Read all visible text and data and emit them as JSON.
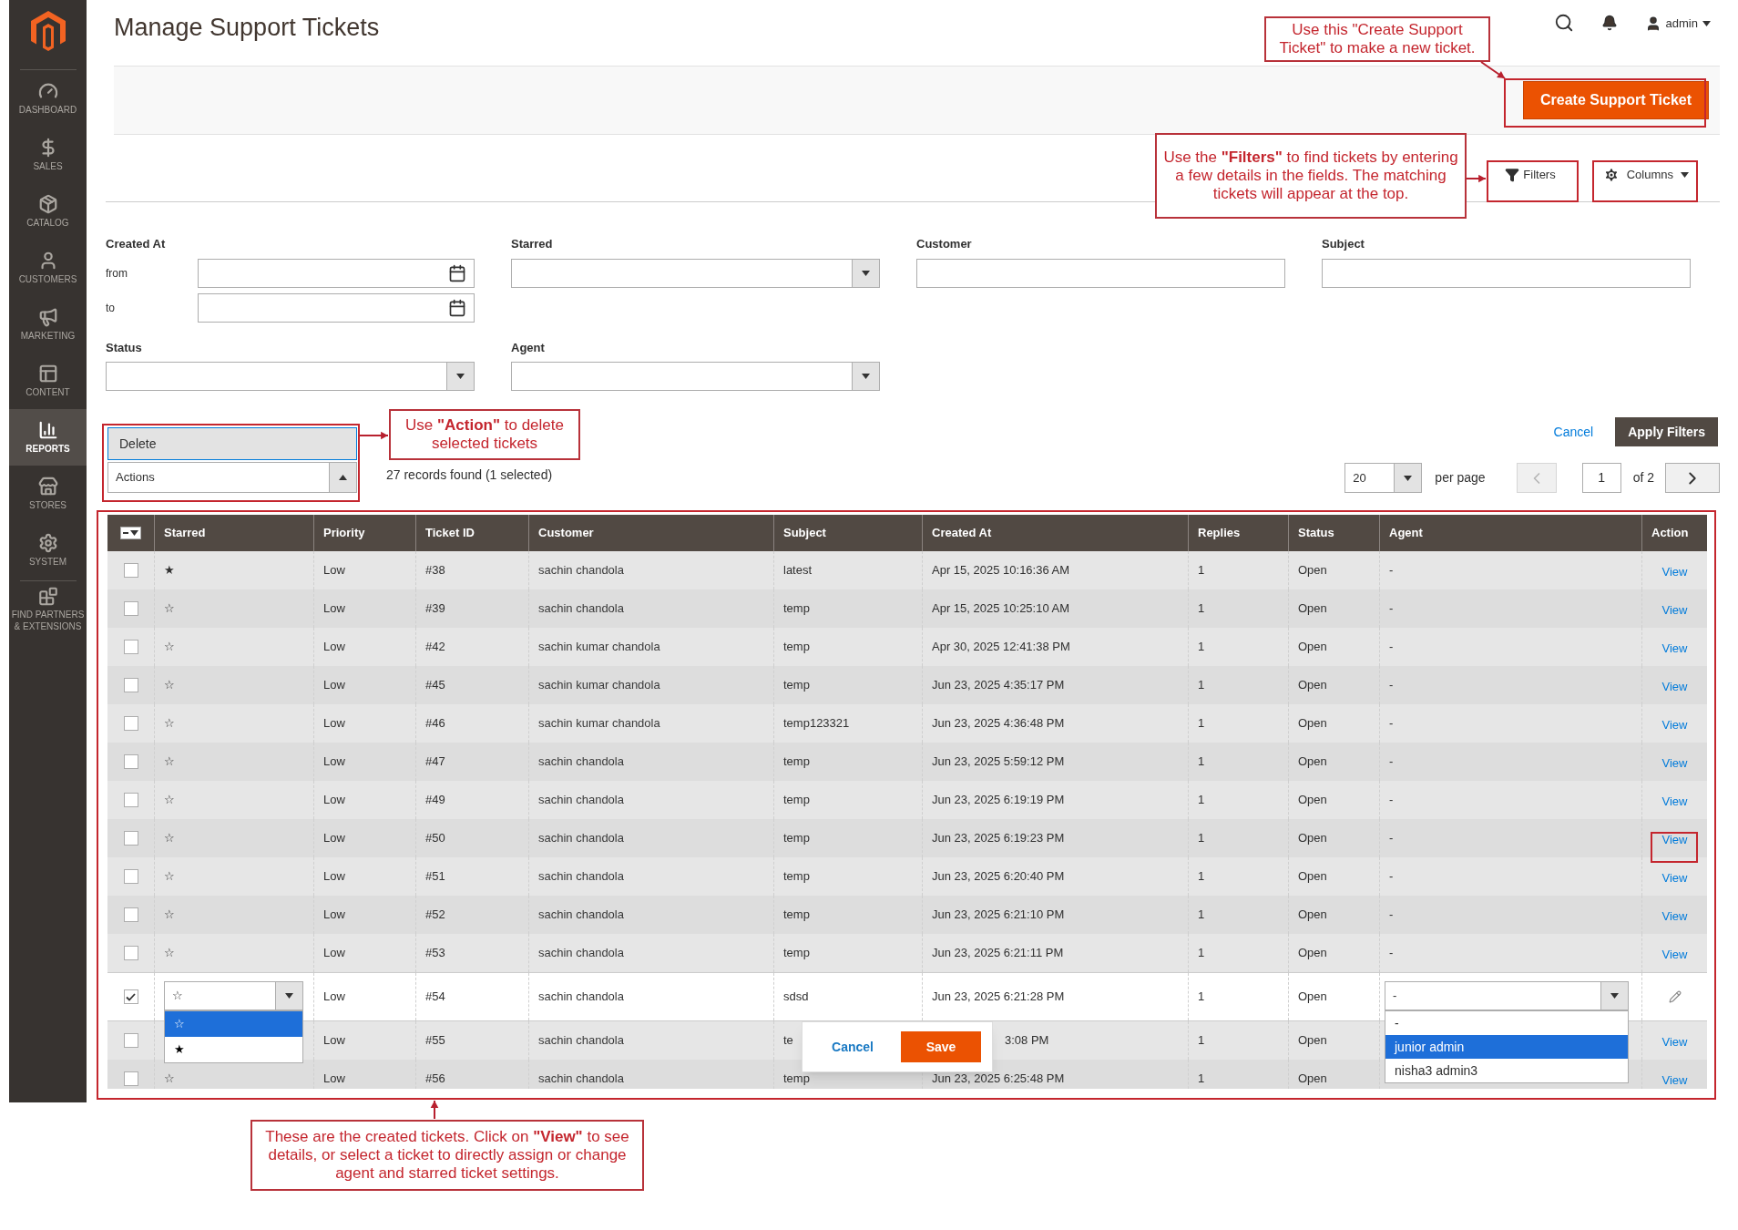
{
  "sidebar": {
    "items": [
      {
        "label": "DASHBOARD",
        "selected": false
      },
      {
        "label": "SALES",
        "selected": false
      },
      {
        "label": "CATALOG",
        "selected": false
      },
      {
        "label": "CUSTOMERS",
        "selected": false
      },
      {
        "label": "MARKETING",
        "selected": false
      },
      {
        "label": "CONTENT",
        "selected": false
      },
      {
        "label": "REPORTS",
        "selected": true
      },
      {
        "label": "STORES",
        "selected": false
      },
      {
        "label": "SYSTEM",
        "selected": false
      },
      {
        "label": "FIND PARTNERS & EXTENSIONS",
        "selected": false
      }
    ]
  },
  "header": {
    "title": "Manage Support Tickets",
    "user": "admin"
  },
  "create_button": "Create Support Ticket",
  "toolbar": {
    "filters_button": "Filters",
    "columns_button": "Columns"
  },
  "filters": {
    "created_at": "Created At",
    "from": "from",
    "to": "to",
    "starred": "Starred",
    "customer": "Customer",
    "subject": "Subject",
    "status": "Status",
    "agent": "Agent"
  },
  "actions": {
    "value": "Actions",
    "expanded": true,
    "options": [
      "Delete"
    ]
  },
  "records": "27 records found (1 selected)",
  "filter_buttons": {
    "cancel": "Cancel",
    "apply": "Apply Filters"
  },
  "pagination": {
    "per_page_value": "20",
    "per_page_label": "per page",
    "page": "1",
    "of": "of 2"
  },
  "table": {
    "mass_select_partial": true,
    "columns": [
      "Starred",
      "Priority",
      "Ticket ID",
      "Customer",
      "Subject",
      "Created At",
      "Replies",
      "Status",
      "Agent",
      "Action"
    ],
    "rows": [
      {
        "kind": "plain",
        "checked": false,
        "starred": "★",
        "priority": "Low",
        "ticket_id": "#38",
        "customer": "sachin chandola",
        "subject": "latest",
        "created_at": "Apr 15, 2025 10:16:36 AM",
        "replies": "1",
        "status": "Open",
        "agent": "-",
        "action": "View"
      },
      {
        "kind": "plain",
        "checked": false,
        "starred": "☆",
        "priority": "Low",
        "ticket_id": "#39",
        "customer": "sachin chandola",
        "subject": "temp",
        "created_at": "Apr 15, 2025 10:25:10 AM",
        "replies": "1",
        "status": "Open",
        "agent": "-",
        "action": "View"
      },
      {
        "kind": "plain",
        "checked": false,
        "starred": "☆",
        "priority": "Low",
        "ticket_id": "#42",
        "customer": "sachin kumar chandola",
        "subject": "temp",
        "created_at": "Apr 30, 2025 12:41:38 PM",
        "replies": "1",
        "status": "Open",
        "agent": "-",
        "action": "View"
      },
      {
        "kind": "plain",
        "checked": false,
        "starred": "☆",
        "priority": "Low",
        "ticket_id": "#45",
        "customer": "sachin kumar chandola",
        "subject": "temp",
        "created_at": "Jun 23, 2025 4:35:17 PM",
        "replies": "1",
        "status": "Open",
        "agent": "-",
        "action": "View"
      },
      {
        "kind": "plain",
        "checked": false,
        "starred": "☆",
        "priority": "Low",
        "ticket_id": "#46",
        "customer": "sachin kumar chandola",
        "subject": "temp123321",
        "created_at": "Jun 23, 2025 4:36:48 PM",
        "replies": "1",
        "status": "Open",
        "agent": "-",
        "action": "View"
      },
      {
        "kind": "plain",
        "checked": false,
        "starred": "☆",
        "priority": "Low",
        "ticket_id": "#47",
        "customer": "sachin chandola",
        "subject": "temp",
        "created_at": "Jun 23, 2025 5:59:12 PM",
        "replies": "1",
        "status": "Open",
        "agent": "-",
        "action": "View"
      },
      {
        "kind": "plain",
        "checked": false,
        "starred": "☆",
        "priority": "Low",
        "ticket_id": "#49",
        "customer": "sachin chandola",
        "subject": "temp",
        "created_at": "Jun 23, 2025 6:19:19 PM",
        "replies": "1",
        "status": "Open",
        "agent": "-",
        "action": "View"
      },
      {
        "kind": "plain",
        "checked": false,
        "starred": "☆",
        "priority": "Low",
        "ticket_id": "#50",
        "customer": "sachin chandola",
        "subject": "temp",
        "created_at": "Jun 23, 2025 6:19:23 PM",
        "replies": "1",
        "status": "Open",
        "agent": "-",
        "action": "View"
      },
      {
        "kind": "plain",
        "checked": false,
        "starred": "☆",
        "priority": "Low",
        "ticket_id": "#51",
        "customer": "sachin chandola",
        "subject": "temp",
        "created_at": "Jun 23, 2025 6:20:40 PM",
        "replies": "1",
        "status": "Open",
        "agent": "-",
        "action": "View"
      },
      {
        "kind": "plain",
        "checked": false,
        "starred": "☆",
        "priority": "Low",
        "ticket_id": "#52",
        "customer": "sachin chandola",
        "subject": "temp",
        "created_at": "Jun 23, 2025 6:21:10 PM",
        "replies": "1",
        "status": "Open",
        "agent": "-",
        "action": "View"
      },
      {
        "kind": "plain",
        "checked": false,
        "starred": "☆",
        "priority": "Low",
        "ticket_id": "#53",
        "customer": "sachin chandola",
        "subject": "temp",
        "created_at": "Jun 23, 2025 6:21:11 PM",
        "replies": "1",
        "status": "Open",
        "agent": "-",
        "action": "View"
      },
      {
        "kind": "editing",
        "checked": true,
        "starred": "☆",
        "priority": "Low",
        "ticket_id": "#54",
        "customer": "sachin chandola",
        "subject": "sdsd",
        "created_at": "Jun 23, 2025 6:21:28 PM",
        "replies": "1",
        "status": "Open",
        "agent": "-"
      },
      {
        "kind": "plain",
        "checked": false,
        "priority": "Low",
        "ticket_id": "#55",
        "customer": "sachin chandola",
        "subject": "te",
        "created_at": "3:08 PM",
        "replies": "1",
        "status": "Open",
        "action": "View"
      },
      {
        "kind": "plain",
        "checked": false,
        "starred": "☆",
        "priority": "Low",
        "ticket_id": "#56",
        "customer": "sachin chandola",
        "subject": "temp",
        "created_at": "Jun 23, 2025 6:25:48 PM",
        "replies": "1",
        "status": "Open",
        "action": "View"
      }
    ]
  },
  "star_options": [
    {
      "label": "☆",
      "selected": true
    },
    {
      "label": "★",
      "selected": false
    }
  ],
  "agent_options": [
    {
      "label": "-",
      "selected": false
    },
    {
      "label": "junior admin",
      "selected": true
    },
    {
      "label": "nisha3 admin3",
      "selected": false
    }
  ],
  "inline_edit": {
    "cancel": "Cancel",
    "save": "Save"
  },
  "annotations": [
    {
      "text": "Use this \"Create Support Ticket\" to make a new ticket."
    },
    {
      "text": "Use the **\"Filters\"** to find tickets by entering a few details in the fields. The matching tickets will appear at the top."
    },
    {
      "text": "Use **\"Action\"** to delete selected tickets"
    },
    {
      "text": "These are the created tickets. Click on **\"View\"** to see details, or select a ticket to directly assign or change agent and starred ticket settings."
    }
  ]
}
